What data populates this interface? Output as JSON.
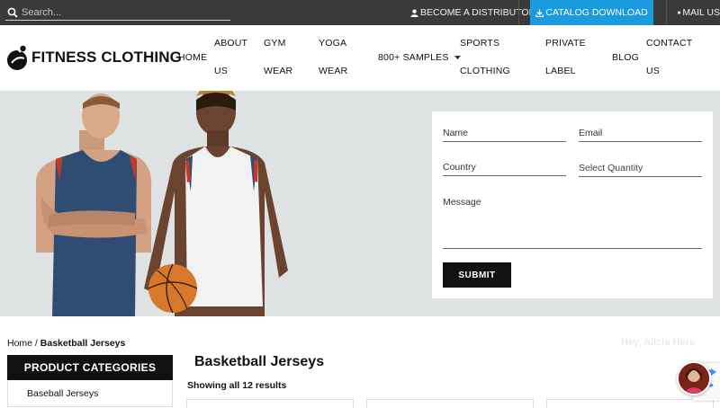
{
  "topbar": {
    "search_placeholder": "Search...",
    "become_distributor": "BECOME A DISTRIBUTOR",
    "catalog_download": "CATALOG DOWNLOAD",
    "mail_us": "MAIL US"
  },
  "logo": {
    "bold": "FITNESS",
    "rest": "CLOTHING"
  },
  "nav": {
    "home": "HOME",
    "about_1": "ABOUT",
    "about_2": "US",
    "gym_1": "GYM",
    "gym_2": "WEAR",
    "yoga_1": "YOGA",
    "yoga_2": "WEAR",
    "samples": "800+ SAMPLES",
    "sports_1": "SPORTS",
    "sports_2": "CLOTHING",
    "private_1": "PRIVATE",
    "private_2": "LABEL",
    "blog": "BLOG",
    "contact_1": "CONTACT",
    "contact_2": "US"
  },
  "form": {
    "name": "Name",
    "email": "Email",
    "country": "Country",
    "quantity": "Select Quantity",
    "message": "Message",
    "submit": "SUBMIT"
  },
  "breadcrumb": {
    "home": "Home",
    "separator": " / ",
    "current": "Basketball Jerseys"
  },
  "greeting": "Hey, Alicia Here",
  "sidebar": {
    "heading": "PRODUCT CATEGORIES",
    "items": [
      "Baseball Jerseys"
    ]
  },
  "main": {
    "title": "Basketball Jerseys",
    "results": "Showing all 12 results"
  },
  "colors": {
    "topbar": "#3a3a3a",
    "accent": "#1a9be0",
    "hero_bg": "#dfe2e3",
    "jersey_blue": "#2f4c72"
  },
  "icons": [
    "search-icon",
    "user-icon",
    "download-icon",
    "mail-icon",
    "chevron-down-icon",
    "chat-avatar",
    "recaptcha-badge"
  ]
}
